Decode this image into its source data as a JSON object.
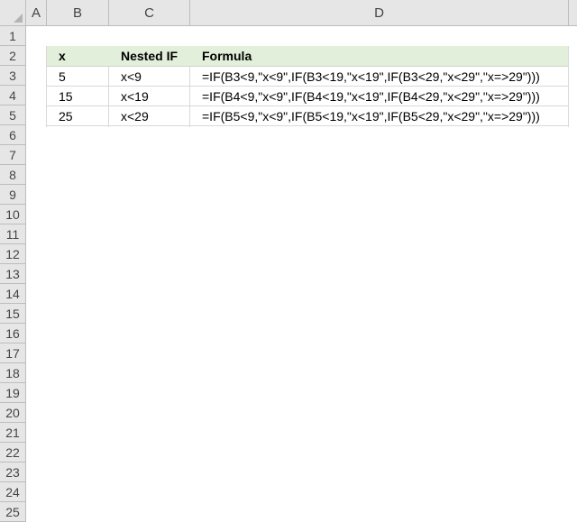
{
  "columns": [
    "A",
    "B",
    "C",
    "D"
  ],
  "rows": [
    "1",
    "2",
    "3",
    "4",
    "5",
    "6",
    "7",
    "8",
    "9",
    "10",
    "11",
    "12",
    "13",
    "14",
    "15",
    "16",
    "17",
    "18",
    "19",
    "20",
    "21",
    "22",
    "23",
    "24",
    "25"
  ],
  "table": {
    "headers": [
      "x",
      "Nested IF",
      "Formula"
    ],
    "rows": [
      [
        "5",
        "x<9",
        "=IF(B3<9,\"x<9\",IF(B3<19,\"x<19\",IF(B3<29,\"x<29\",\"x=>29\")))"
      ],
      [
        "15",
        "x<19",
        "=IF(B4<9,\"x<9\",IF(B4<19,\"x<19\",IF(B4<29,\"x<29\",\"x=>29\")))"
      ],
      [
        "25",
        "x<29",
        "=IF(B5<9,\"x<9\",IF(B5<19,\"x<19\",IF(B5<29,\"x<29\",\"x=>29\")))"
      ]
    ]
  }
}
